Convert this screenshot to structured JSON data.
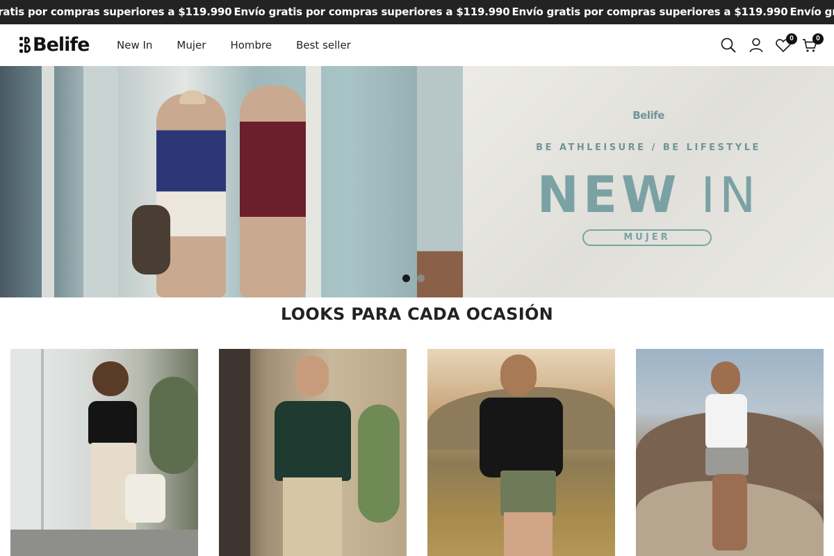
{
  "announcement": {
    "items": [
      "Envío gratis por compras superiores a $119.990",
      "Envío gratis por compras superiores a $119.990",
      "Envío gratis por compras superiores a $119.990",
      "Envío gratis por compras superiores a $119.990"
    ]
  },
  "header": {
    "logo_text": "Belife",
    "nav": [
      "New In",
      "Mujer",
      "Hombre",
      "Best seller"
    ],
    "wishlist_count": "0",
    "cart_count": "0"
  },
  "hero": {
    "banner_brand": "Belife",
    "banner_tagline": "BE ATHLEISURE / BE LIFESTYLE",
    "headline_bold": "NEW",
    "headline_light": "IN",
    "cta_label": "MUJER",
    "active_slide": 1,
    "slide_count": 2
  },
  "section": {
    "title": "LOOKS PARA CADA OCASIÓN"
  },
  "colors": {
    "topbar_bg": "#232323",
    "banner_accent": "#7aa2a4",
    "text": "#222222"
  }
}
